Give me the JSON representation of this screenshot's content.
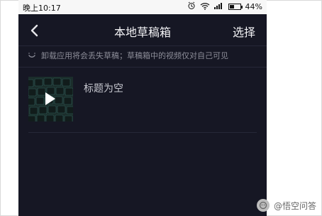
{
  "status_bar": {
    "time": "晚上10:17",
    "battery_percent": "44%",
    "battery_level": 0.44,
    "icons": [
      "alarm-icon",
      "wifi-icon",
      "signal-icon",
      "battery-icon"
    ]
  },
  "navbar": {
    "title": "本地草稿箱",
    "select_label": "选择",
    "back_icon": "chevron-left-icon"
  },
  "notice": {
    "icon": "smile-icon",
    "text": "卸载应用将会丢失草稿；草稿箱中的视频仅对自己可见"
  },
  "drafts": [
    {
      "title": "标题为空",
      "thumbnail_icon": "play-icon"
    }
  ],
  "watermark": {
    "text": "@悟空问答"
  }
}
